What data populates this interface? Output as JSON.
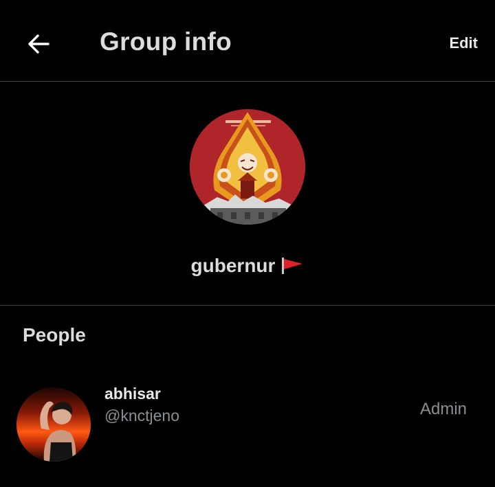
{
  "header": {
    "title": "Group info",
    "edit_label": "Edit",
    "back_icon": "arrow-left-icon"
  },
  "group": {
    "name": "gubernur",
    "flag_icon": "red-flag-icon",
    "avatar_colors": {
      "background": "#b0252a",
      "accent": "#f0a020"
    }
  },
  "people": {
    "section_title": "People",
    "members": [
      {
        "name": "abhisar",
        "handle": "@knctjeno",
        "role": "Admin"
      }
    ]
  },
  "colors": {
    "background": "#000000",
    "primary_text": "#e7e9ea",
    "secondary_text": "#8b8f93",
    "divider": "#3e4144"
  }
}
